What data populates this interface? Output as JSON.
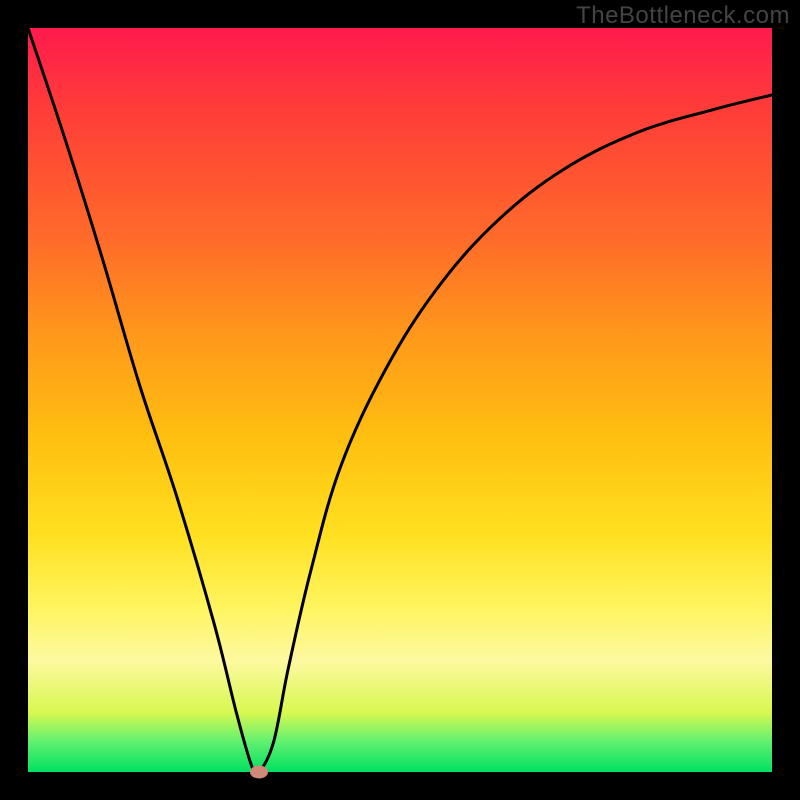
{
  "watermark": "TheBottleneck.com",
  "chart_data": {
    "type": "line",
    "title": "",
    "xlabel": "",
    "ylabel": "",
    "xlim": [
      0,
      100
    ],
    "ylim": [
      0,
      100
    ],
    "grid": false,
    "legend": false,
    "min_point": {
      "x": 31,
      "y": 0
    },
    "series": [
      {
        "name": "bottleneck-curve",
        "x": [
          0,
          5,
          10,
          15,
          20,
          25,
          28,
          30,
          31,
          33,
          35,
          38,
          42,
          48,
          55,
          63,
          72,
          82,
          92,
          100
        ],
        "y": [
          100,
          85,
          69,
          52,
          37,
          20,
          8,
          1,
          0,
          4,
          14,
          27,
          41,
          54,
          65,
          74,
          81,
          86,
          89,
          91
        ]
      }
    ],
    "background": {
      "type": "vertical-gradient",
      "stops": [
        {
          "pos": 0.0,
          "color": "#ff1a4d"
        },
        {
          "pos": 0.1,
          "color": "#ff3a3a"
        },
        {
          "pos": 0.28,
          "color": "#ff6a2a"
        },
        {
          "pos": 0.42,
          "color": "#ff9a1a"
        },
        {
          "pos": 0.55,
          "color": "#ffbf10"
        },
        {
          "pos": 0.68,
          "color": "#ffe020"
        },
        {
          "pos": 0.78,
          "color": "#fff560"
        },
        {
          "pos": 0.85,
          "color": "#fdf9a0"
        },
        {
          "pos": 0.92,
          "color": "#d8f850"
        },
        {
          "pos": 0.96,
          "color": "#5ff070"
        },
        {
          "pos": 1.0,
          "color": "#00e060"
        }
      ]
    }
  }
}
